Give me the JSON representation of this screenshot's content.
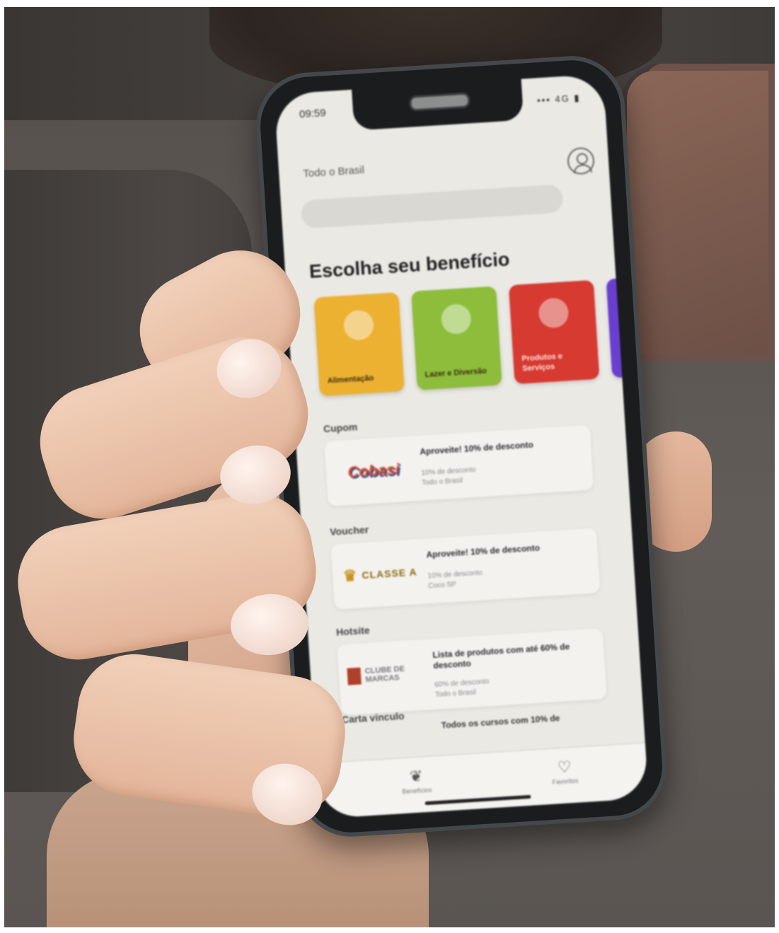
{
  "status_bar": {
    "time": "09:59",
    "icons": "▪▪▪ 4G ▮"
  },
  "header": {
    "location": "Todo o Brasil",
    "search_placeholder": ""
  },
  "main": {
    "title": "Escolha seu benefício",
    "categories": [
      {
        "label": "Alimentação",
        "color": "#ecb131"
      },
      {
        "label": "Lazer e Diversão",
        "color": "#8dbd3b"
      },
      {
        "label": "Produtos e Serviços",
        "color": "#d63a31"
      },
      {
        "label": "",
        "color": "#6a3fd0"
      }
    ],
    "sections": [
      {
        "title": "Cupom",
        "card": {
          "logo": "Cobasi",
          "title": "Aproveite! 10% de desconto",
          "line1": "10% de desconto",
          "line2": "Todo o Brasil"
        }
      },
      {
        "title": "Voucher",
        "card": {
          "logo": "CLASSE A",
          "title": "Aproveite! 10% de desconto",
          "line1": "10% de desconto",
          "line2": "Coco SP"
        }
      },
      {
        "title": "Hotsite",
        "card": {
          "logo": "CLUBE DE MARCAS",
          "title": "Lista de produtos com até 60% de desconto",
          "line1": "60% de desconto",
          "line2": "Todo o Brasil"
        }
      },
      {
        "title": "Carta vinculo",
        "teaser": "Todos os cursos com 10% de"
      }
    ]
  },
  "tabbar": {
    "items": [
      {
        "label": "Benefícios",
        "icon": "leaf-icon"
      },
      {
        "label": "Favoritos",
        "icon": "heart-icon"
      }
    ]
  }
}
